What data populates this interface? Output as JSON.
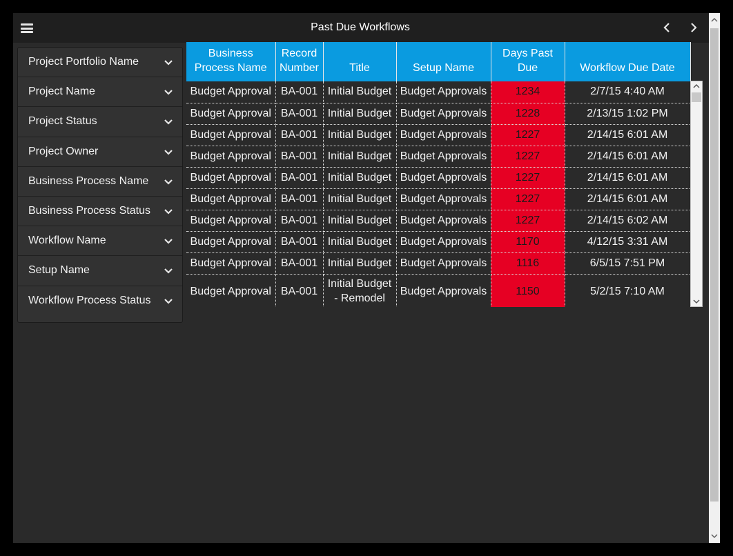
{
  "header": {
    "title": "Past Due Workflows",
    "menu_icon": "hamburger-menu-icon",
    "prev_icon": "chevron-left-icon",
    "next_icon": "chevron-right-icon"
  },
  "filters": [
    {
      "label": "Project Portfolio Name"
    },
    {
      "label": "Project Name"
    },
    {
      "label": "Project Status"
    },
    {
      "label": "Project Owner"
    },
    {
      "label": "Business Process Name"
    },
    {
      "label": "Business Process Status"
    },
    {
      "label": "Workflow Name"
    },
    {
      "label": "Setup Name"
    },
    {
      "label": "Workflow Process Status"
    }
  ],
  "table": {
    "columns": [
      "Business Process Name",
      "Record Number",
      "Title",
      "Setup Name",
      "Days Past Due",
      "Workflow Due Date"
    ],
    "rows": [
      [
        "Budget Approval",
        "BA-001",
        "Initial Budget",
        "Budget Approvals",
        "1234",
        "2/7/15 4:40 AM"
      ],
      [
        "Budget Approval",
        "BA-001",
        "Initial Budget",
        "Budget Approvals",
        "1228",
        "2/13/15 1:02 PM"
      ],
      [
        "Budget Approval",
        "BA-001",
        "Initial Budget",
        "Budget Approvals",
        "1227",
        "2/14/15 6:01 AM"
      ],
      [
        "Budget Approval",
        "BA-001",
        "Initial Budget",
        "Budget Approvals",
        "1227",
        "2/14/15 6:01 AM"
      ],
      [
        "Budget Approval",
        "BA-001",
        "Initial Budget",
        "Budget Approvals",
        "1227",
        "2/14/15 6:01 AM"
      ],
      [
        "Budget Approval",
        "BA-001",
        "Initial Budget",
        "Budget Approvals",
        "1227",
        "2/14/15 6:01 AM"
      ],
      [
        "Budget Approval",
        "BA-001",
        "Initial Budget",
        "Budget Approvals",
        "1227",
        "2/14/15 6:02 AM"
      ],
      [
        "Budget Approval",
        "BA-001",
        "Initial Budget",
        "Budget Approvals",
        "1170",
        "4/12/15 3:31 AM"
      ],
      [
        "Budget Approval",
        "BA-001",
        "Initial Budget",
        "Budget Approvals",
        "1116",
        "6/5/15 7:51 PM"
      ],
      [
        "Budget Approval",
        "BA-001",
        "Initial Budget - Remodel",
        "Budget Approvals",
        "1150",
        "5/2/15 7:10 AM"
      ]
    ]
  },
  "colors": {
    "header_bg": "#0a9be0",
    "past_due_red": "#e60023",
    "panel_bg": "#2a2a2a"
  }
}
